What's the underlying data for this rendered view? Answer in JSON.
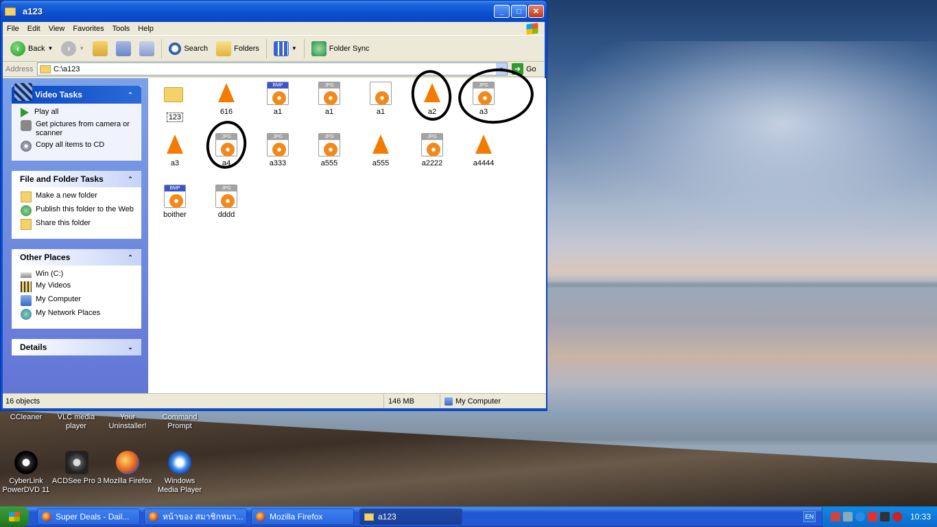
{
  "window": {
    "title": "a123",
    "menu": [
      "File",
      "Edit",
      "View",
      "Favorites",
      "Tools",
      "Help"
    ],
    "toolbar": {
      "back": "Back",
      "search": "Search",
      "folders": "Folders",
      "folder_sync": "Folder Sync"
    },
    "address": {
      "label": "Address",
      "path": "C:\\a123",
      "go": "Go"
    },
    "buttons": {
      "minimize": "_",
      "maximize": "□",
      "close": "✕"
    }
  },
  "taskpane": {
    "video": {
      "title": "Video Tasks",
      "items": [
        "Play all",
        "Get pictures from camera or scanner",
        "Copy all items to CD"
      ]
    },
    "file": {
      "title": "File and Folder Tasks",
      "items": [
        "Make a new folder",
        "Publish this folder to the Web",
        "Share this folder"
      ]
    },
    "other": {
      "title": "Other Places",
      "items": [
        "Win (C:)",
        "My Videos",
        "My Computer",
        "My Network Places"
      ]
    },
    "details": {
      "title": "Details"
    }
  },
  "files": [
    {
      "name": "123",
      "type": "folder"
    },
    {
      "name": "616",
      "type": "vlc"
    },
    {
      "name": "a1",
      "type": "bmp"
    },
    {
      "name": "a1",
      "type": "jpg"
    },
    {
      "name": "a1",
      "type": "audio"
    },
    {
      "name": "a2",
      "type": "vlc"
    },
    {
      "name": "a3",
      "type": "jpg"
    },
    {
      "name": "a3",
      "type": "vlc"
    },
    {
      "name": "a4",
      "type": "jpg"
    },
    {
      "name": "a333",
      "type": "jpg"
    },
    {
      "name": "a555",
      "type": "jpg"
    },
    {
      "name": "a555",
      "type": "vlc"
    },
    {
      "name": "a2222",
      "type": "jpg"
    },
    {
      "name": "a4444",
      "type": "vlc"
    },
    {
      "name": "boither",
      "type": "bmp"
    },
    {
      "name": "dddd",
      "type": "jpg"
    }
  ],
  "status": {
    "objects": "16 objects",
    "size": "146 MB",
    "location": "My Computer"
  },
  "desktop": {
    "icons": [
      {
        "label": "CCleaner"
      },
      {
        "label": "VLC media player"
      },
      {
        "label": "Your Uninstaller!"
      },
      {
        "label": "Command Prompt"
      },
      {
        "label": "CyberLink PowerDVD 11"
      },
      {
        "label": "ACDSee Pro 3"
      },
      {
        "label": "Mozilla Firefox"
      },
      {
        "label": "Windows Media Player"
      }
    ]
  },
  "taskbar": {
    "tasks": [
      "Super Deals - Dail...",
      "หน้าของ สมาชิกหมา...",
      "Mozilla Firefox",
      "a123"
    ],
    "lang": "EN",
    "clock": "10:33"
  }
}
